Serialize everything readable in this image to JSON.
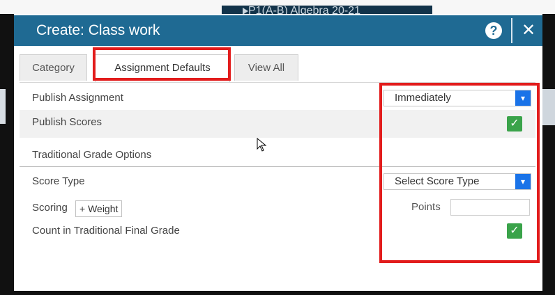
{
  "background": {
    "course_label": "P1(A-B) Algebra    20-21"
  },
  "modal": {
    "title": "Create: Class work",
    "help_icon": "?",
    "close_icon": "✕"
  },
  "tabs": [
    {
      "label": "Category"
    },
    {
      "label": "Assignment Defaults"
    },
    {
      "label": "View All"
    }
  ],
  "fields": {
    "publish_assignment": {
      "label": "Publish Assignment",
      "value": "Immediately"
    },
    "publish_scores": {
      "label": "Publish Scores",
      "checked": true
    },
    "traditional_grade_options": {
      "label": "Traditional Grade Options"
    },
    "score_type": {
      "label": "Score Type",
      "value": "Select Score Type"
    },
    "scoring": {
      "label": "Scoring",
      "weight_button": "+ Weight",
      "points_label": "Points",
      "points_value": ""
    },
    "count_in_final": {
      "label": "Count in Traditional Final Grade",
      "checked": true
    }
  },
  "icons": {
    "chevron": "chevron-down-icon",
    "check": "checkmark-icon"
  },
  "colors": {
    "header": "#1f6a93",
    "highlight": "#e21c1c",
    "checkbox": "#3aa34a",
    "select_arrow": "#1a73e8"
  }
}
